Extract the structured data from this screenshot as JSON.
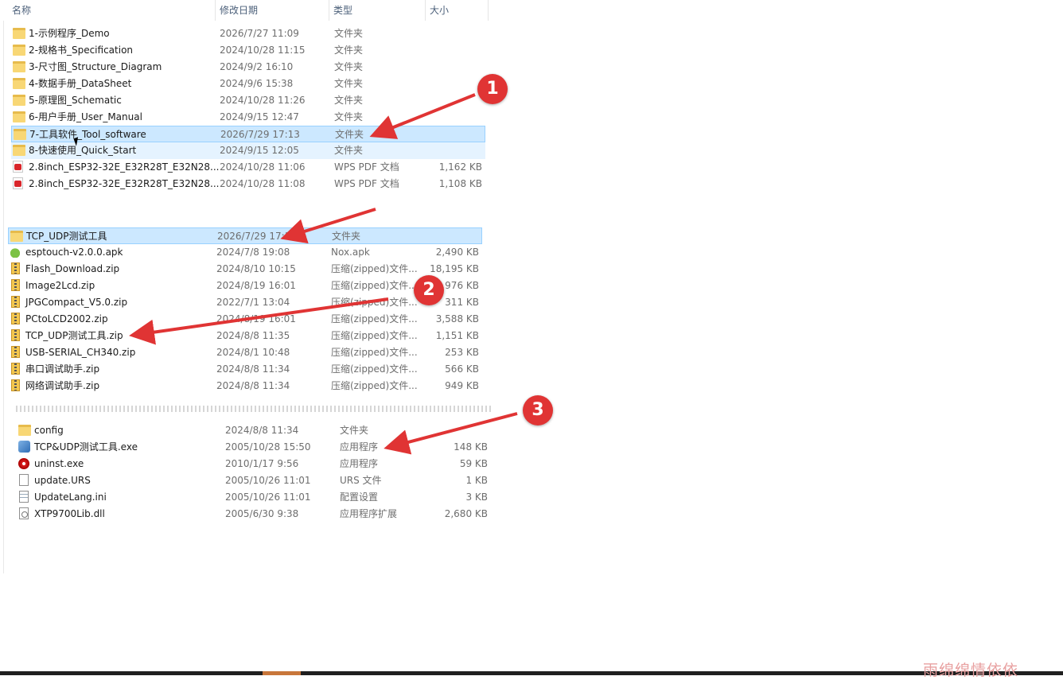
{
  "header": {
    "columns": [
      {
        "label": "名称"
      },
      {
        "label": "修改日期"
      },
      {
        "label": "类型"
      },
      {
        "label": "大小"
      }
    ]
  },
  "list1": [
    {
      "name": "1-示例程序_Demo",
      "date": "2026/7/27 11:09",
      "type": "文件夹",
      "size": "",
      "icon": "folder"
    },
    {
      "name": "2-规格书_Specification",
      "date": "2024/10/28 11:15",
      "type": "文件夹",
      "size": "",
      "icon": "folder"
    },
    {
      "name": "3-尺寸图_Structure_Diagram",
      "date": "2024/9/2 16:10",
      "type": "文件夹",
      "size": "",
      "icon": "folder"
    },
    {
      "name": "4-数据手册_DataSheet",
      "date": "2024/9/6 15:38",
      "type": "文件夹",
      "size": "",
      "icon": "folder"
    },
    {
      "name": "5-原理图_Schematic",
      "date": "2024/10/28 11:26",
      "type": "文件夹",
      "size": "",
      "icon": "folder"
    },
    {
      "name": "6-用户手册_User_Manual",
      "date": "2024/9/15 12:47",
      "type": "文件夹",
      "size": "",
      "icon": "folder"
    },
    {
      "name": "7-工具软件_Tool_software",
      "date": "2026/7/29 17:13",
      "type": "文件夹",
      "size": "",
      "icon": "folder"
    },
    {
      "name": "8-快速使用_Quick_Start",
      "date": "2024/9/15 12:05",
      "type": "文件夹",
      "size": "",
      "icon": "folder"
    },
    {
      "name": "2.8inch_ESP32-32E_E32R28T_E32N28...",
      "date": "2024/10/28 11:06",
      "type": "WPS PDF 文档",
      "size": "1,162 KB",
      "icon": "pdf"
    },
    {
      "name": "2.8inch_ESP32-32E_E32R28T_E32N28...",
      "date": "2024/10/28 11:08",
      "type": "WPS PDF 文档",
      "size": "1,108 KB",
      "icon": "pdf"
    }
  ],
  "list2": [
    {
      "name": "TCP_UDP测试工具",
      "date": "2026/7/29 17:13",
      "type": "文件夹",
      "size": "",
      "icon": "folder"
    },
    {
      "name": "esptouch-v2.0.0.apk",
      "date": "2024/7/8 19:08",
      "type": "Nox.apk",
      "size": "2,490 KB",
      "icon": "apk"
    },
    {
      "name": "Flash_Download.zip",
      "date": "2024/8/10 10:15",
      "type": "压缩(zipped)文件...",
      "size": "18,195 KB",
      "icon": "zip"
    },
    {
      "name": "Image2Lcd.zip",
      "date": "2024/8/19 16:01",
      "type": "压缩(zipped)文件...",
      "size": "976 KB",
      "icon": "zip"
    },
    {
      "name": "JPGCompact_V5.0.zip",
      "date": "2022/7/1 13:04",
      "type": "压缩(zipped)文件...",
      "size": "311 KB",
      "icon": "zip"
    },
    {
      "name": "PCtoLCD2002.zip",
      "date": "2024/8/19 16:01",
      "type": "压缩(zipped)文件...",
      "size": "3,588 KB",
      "icon": "zip"
    },
    {
      "name": "TCP_UDP测试工具.zip",
      "date": "2024/8/8 11:35",
      "type": "压缩(zipped)文件...",
      "size": "1,151 KB",
      "icon": "zip"
    },
    {
      "name": "USB-SERIAL_CH340.zip",
      "date": "2024/8/1 10:48",
      "type": "压缩(zipped)文件...",
      "size": "253 KB",
      "icon": "zip"
    },
    {
      "name": "串口调试助手.zip",
      "date": "2024/8/8 11:34",
      "type": "压缩(zipped)文件...",
      "size": "566 KB",
      "icon": "zip"
    },
    {
      "name": "网络调试助手.zip",
      "date": "2024/8/8 11:34",
      "type": "压缩(zipped)文件...",
      "size": "949 KB",
      "icon": "zip"
    }
  ],
  "list3": [
    {
      "name": "config",
      "date": "2024/8/8 11:34",
      "type": "文件夹",
      "size": "",
      "icon": "folder"
    },
    {
      "name": "TCP&UDP测试工具.exe",
      "date": "2005/10/28 15:50",
      "type": "应用程序",
      "size": "148 KB",
      "icon": "exe"
    },
    {
      "name": "uninst.exe",
      "date": "2010/1/17 9:56",
      "type": "应用程序",
      "size": "59 KB",
      "icon": "uninst"
    },
    {
      "name": "update.URS",
      "date": "2005/10/26 11:01",
      "type": "URS 文件",
      "size": "1 KB",
      "icon": "file"
    },
    {
      "name": "UpdateLang.ini",
      "date": "2005/10/26 11:01",
      "type": "配置设置",
      "size": "3 KB",
      "icon": "ini"
    },
    {
      "name": "XTP9700Lib.dll",
      "date": "2005/6/30 9:38",
      "type": "应用程序扩展",
      "size": "2,680 KB",
      "icon": "dll"
    }
  ],
  "annotations": {
    "badge1": "1",
    "badge2": "2",
    "badge3": "3",
    "arrow_color": "#e03434"
  },
  "watermark": "雨绵绵情依依"
}
